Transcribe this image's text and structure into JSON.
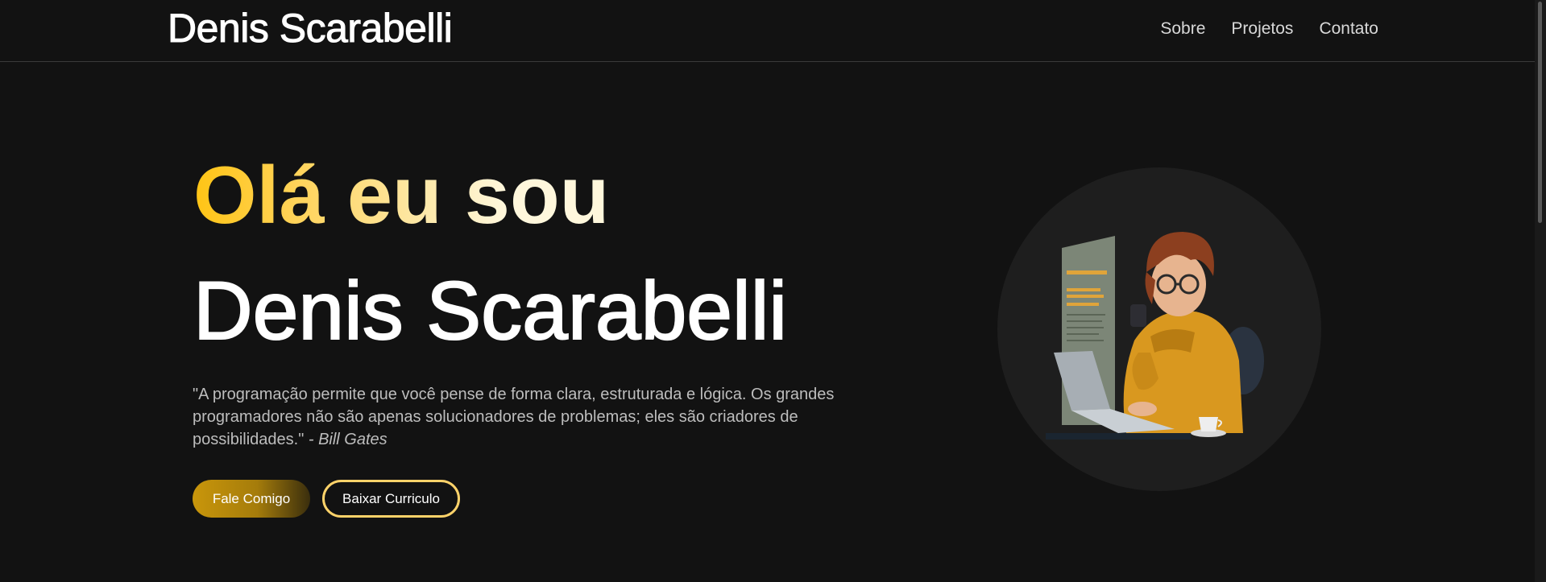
{
  "header": {
    "brand": "Denis Scarabelli",
    "nav": [
      "Sobre",
      "Projetos",
      "Contato"
    ]
  },
  "hero": {
    "greeting": "Olá eu sou",
    "name": "Denis Scarabelli",
    "quote_text": "\"A programação permite que você pense de forma clara, estruturada e lógica. Os grandes programadores não são apenas solucionadores de problemas; eles são criadores de possibilidades.\"",
    "quote_author": "- Bill Gates",
    "buttons": {
      "contact": "Fale Comigo",
      "resume": "Baixar Curriculo"
    }
  },
  "colors": {
    "background": "#121212",
    "accent": "#ffc414",
    "accent_light": "#ffd36a",
    "text": "#ffffff",
    "muted": "#bdbdbd"
  },
  "icons": {
    "illustration": "developer-with-laptop-illustration"
  }
}
